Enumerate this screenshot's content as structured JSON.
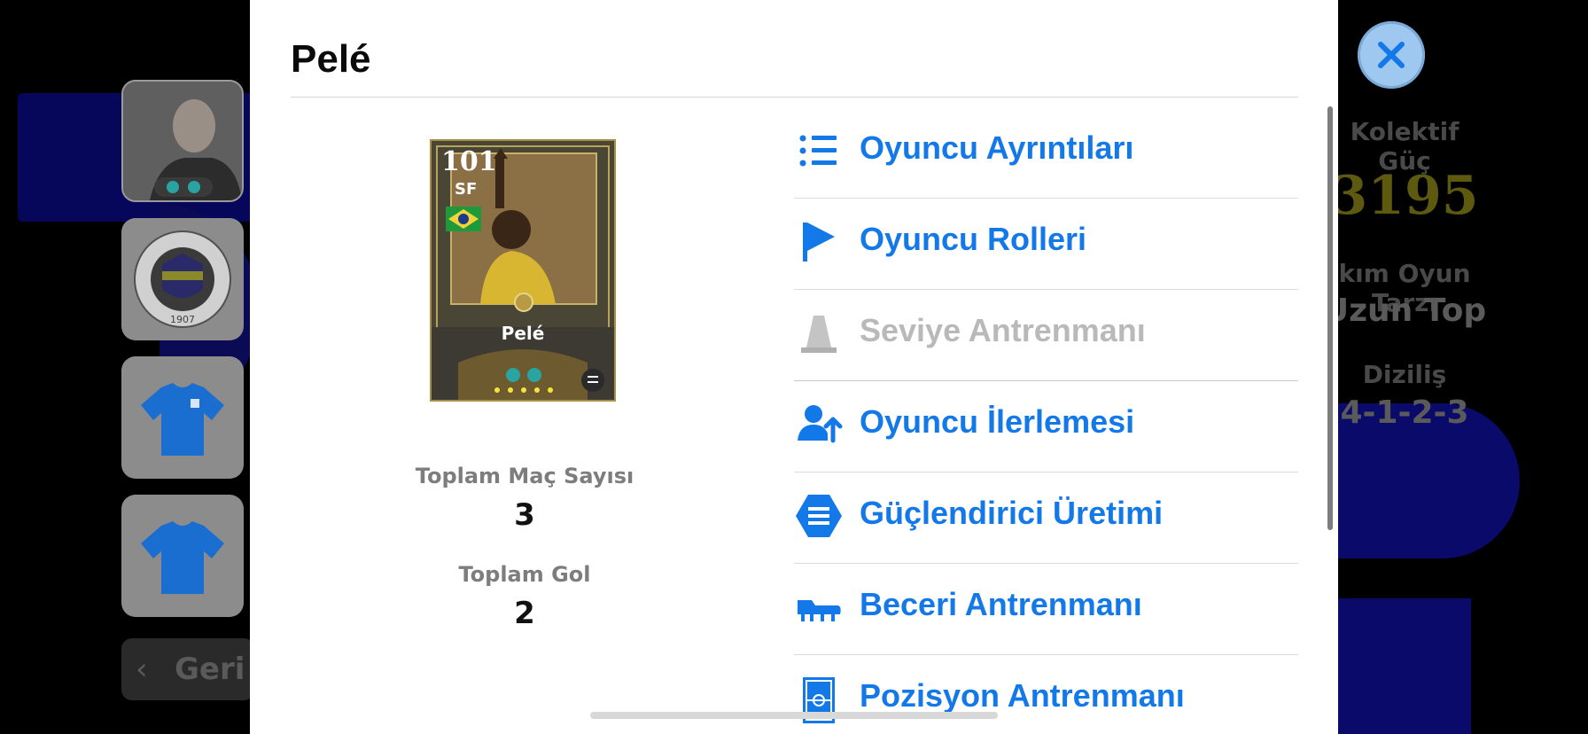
{
  "modal": {
    "title": "Pelé",
    "card": {
      "rating": "101",
      "position": "SF",
      "name": "Pelé",
      "flag_icon": "brazil-flag-icon",
      "stars": 5
    },
    "stats": [
      {
        "label": "Toplam Maç Sayısı",
        "value": "3"
      },
      {
        "label": "Toplam Gol",
        "value": "2"
      }
    ],
    "menu": [
      {
        "label": "Oyuncu Ayrıntıları",
        "icon": "list-icon",
        "enabled": true
      },
      {
        "label": "Oyuncu Rolleri",
        "icon": "flag-icon",
        "enabled": true
      },
      {
        "label": "Seviye Antrenmanı",
        "icon": "training-cone-icon",
        "enabled": false
      },
      {
        "label": "Oyuncu İlerlemesi",
        "icon": "user-progress-icon",
        "enabled": true
      },
      {
        "label": "Güçlendirici Üretimi",
        "icon": "booster-hexagon-icon",
        "enabled": true
      },
      {
        "label": "Beceri Antrenmanı",
        "icon": "football-boot-icon",
        "enabled": true
      },
      {
        "label": "Pozisyon Antrenmanı",
        "icon": "pitch-icon",
        "enabled": true
      }
    ]
  },
  "background": {
    "right_stats": {
      "team_strength_label": "Kolektif Güç",
      "team_strength_value": "3195",
      "playstyle_label": "kım Oyun Tarzı",
      "playstyle_value": "Uzun Top",
      "formation_label": "Diziliş",
      "formation_value": "4-1-2-3"
    },
    "back_label": "Geri"
  },
  "colors": {
    "accent": "#1479e8",
    "disabled": "#b9b9b9",
    "close_button": "#9ec8ef"
  }
}
